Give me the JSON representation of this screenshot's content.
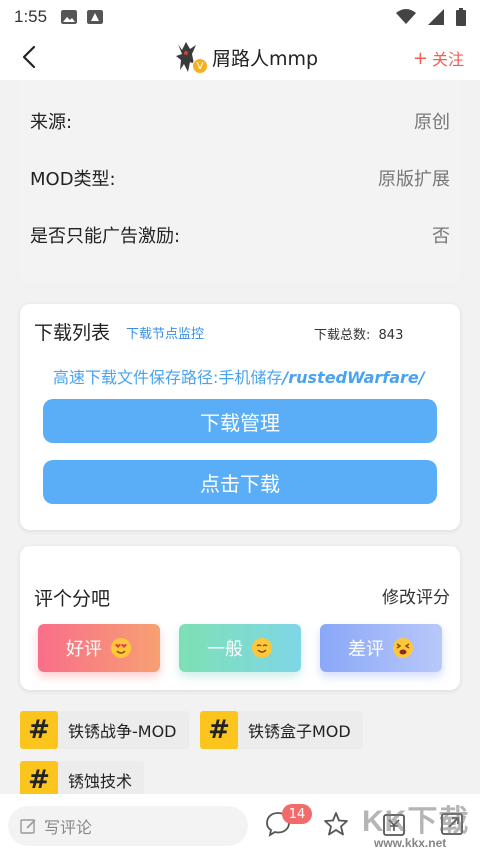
{
  "status_bar": {
    "time": "1:55",
    "icons": [
      "gallery-icon",
      "app-notification-icon",
      "wifi-icon",
      "signal-icon",
      "battery-icon"
    ]
  },
  "header": {
    "author_name": "屑路人mmp",
    "follow_label": "关注",
    "verified_badge": "V"
  },
  "info": {
    "rows": [
      {
        "label": "来源:",
        "value": "原创"
      },
      {
        "label": "MOD类型:",
        "value": "原版扩展"
      },
      {
        "label": "是否只能广告激励:",
        "value": "否"
      }
    ]
  },
  "download": {
    "title": "下载列表",
    "monitor_link": "下载节点监控",
    "total_label": "下载总数:",
    "total_value": "843",
    "path_prefix": "高速下载文件保存路径:手机储存",
    "path_value": "/rustedWarfare/",
    "manage_label": "下载管理",
    "download_label": "点击下载"
  },
  "rating": {
    "title": "评个分吧",
    "edit_label": "修改评分",
    "good_label": "好评",
    "mid_label": "一般",
    "bad_label": "差评"
  },
  "tags": {
    "hash": "#",
    "items": [
      "铁锈战争-MOD",
      "铁锈盒子MOD",
      "锈蚀技术"
    ]
  },
  "bottom_bar": {
    "comment_placeholder": "写评论",
    "comment_count": "14"
  },
  "watermark": {
    "main": "KK下载",
    "url": "www.kkx.net"
  },
  "colors": {
    "accent_blue": "#5aaef8",
    "link_blue": "#3a8ee6",
    "follow_red": "#f25c54",
    "tag_yellow": "#fbc51e",
    "badge_red": "#f26a6a"
  }
}
